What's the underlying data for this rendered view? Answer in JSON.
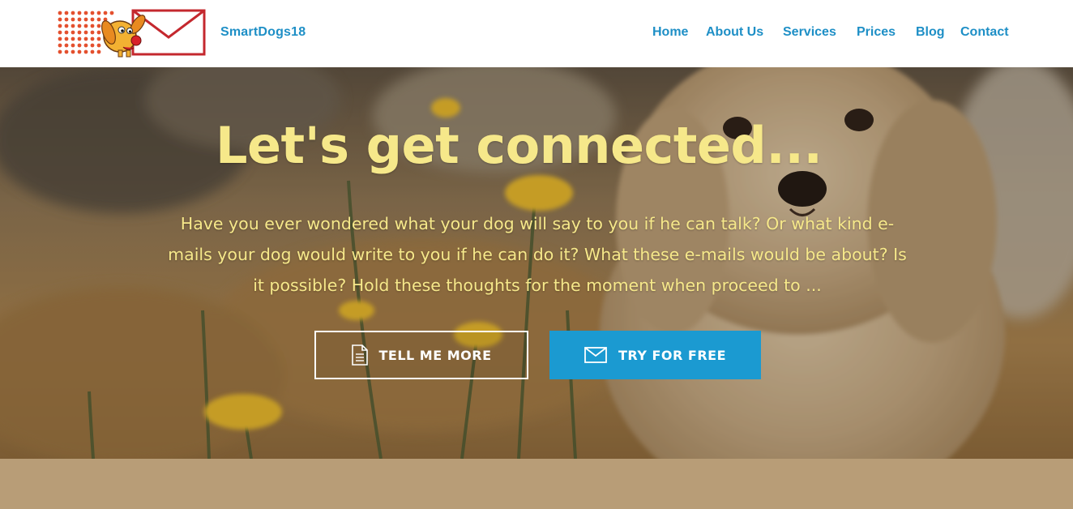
{
  "header": {
    "logo_icon": "dog-envelope-logo",
    "brand": "SmartDogs18",
    "nav": [
      {
        "label": "Home"
      },
      {
        "label": "About Us"
      },
      {
        "label": "Services"
      },
      {
        "label": "Prices"
      },
      {
        "label": "Blog"
      },
      {
        "label": "Contact"
      }
    ]
  },
  "hero": {
    "title": "Let's get connected...",
    "text": "Have you ever wondered what your dog will say to you if he can talk? Or what kind e-mails your dog would write to you if he can do it? What these e-mails would be about? Is it possible? Hold these thoughts  for the moment when proceed to ...",
    "buttons": {
      "tell_more": {
        "label": "TELL ME MORE",
        "icon": "document-icon"
      },
      "try_free": {
        "label": "TRY FOR FREE",
        "icon": "envelope-icon"
      }
    }
  },
  "colors": {
    "nav": "#1e8fc6",
    "accent": "#1b9ad1",
    "hero_text": "#f6e88a",
    "band": "#b89d77"
  }
}
